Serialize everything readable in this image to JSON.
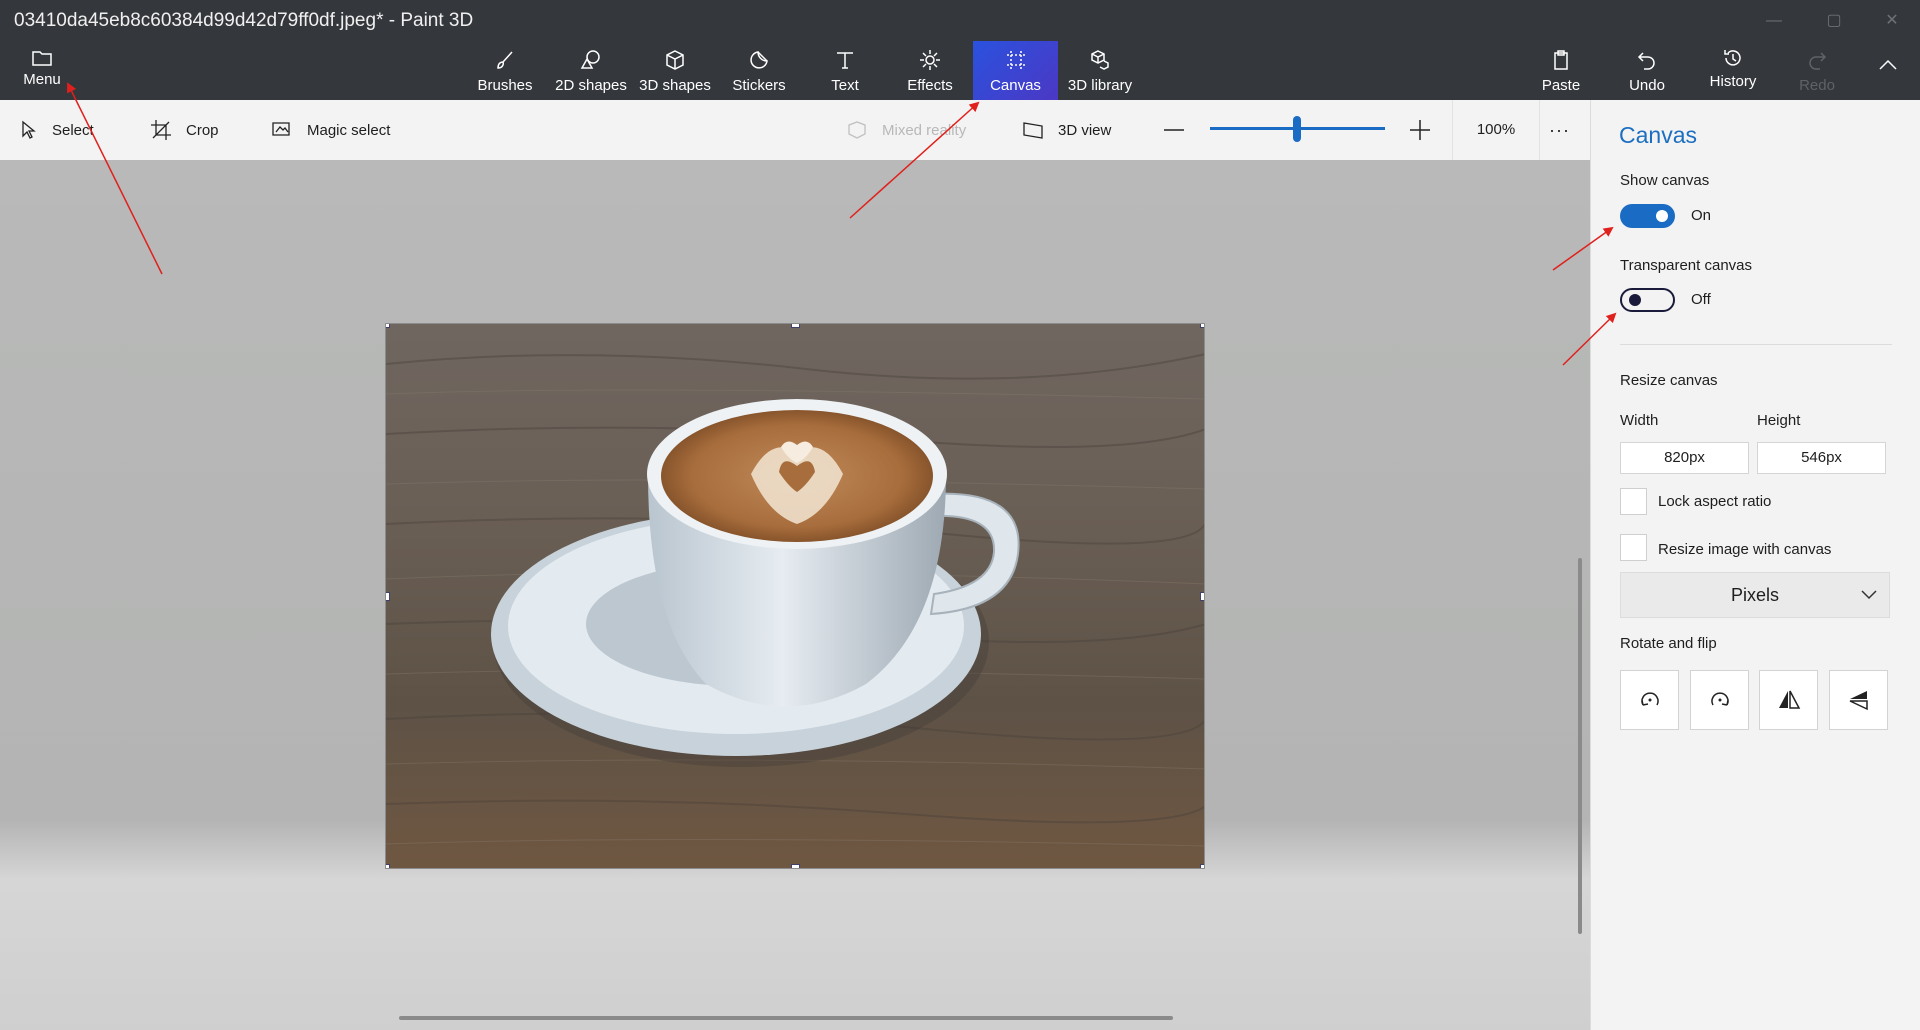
{
  "window": {
    "title": "03410da45eb8c60384d99d42d79ff0df.jpeg* - Paint 3D"
  },
  "ribbon": {
    "menu": "Menu",
    "tools": [
      {
        "label": "Brushes",
        "icon": "brush-icon"
      },
      {
        "label": "2D shapes",
        "icon": "2d-shapes-icon"
      },
      {
        "label": "3D shapes",
        "icon": "3d-shapes-icon"
      },
      {
        "label": "Stickers",
        "icon": "stickers-icon"
      },
      {
        "label": "Text",
        "icon": "text-icon"
      },
      {
        "label": "Effects",
        "icon": "effects-icon"
      },
      {
        "label": "Canvas",
        "icon": "canvas-icon",
        "active": true
      },
      {
        "label": "3D library",
        "icon": "3d-library-icon"
      }
    ],
    "paste": "Paste",
    "undo": "Undo",
    "history": "History",
    "redo": "Redo"
  },
  "toolbar": {
    "select": "Select",
    "crop": "Crop",
    "magic_select": "Magic select",
    "mixed_reality": "Mixed reality",
    "view_3d": "3D view",
    "zoom_level": "100%",
    "zoom_slider_fraction": 0.58,
    "more": "···"
  },
  "panel": {
    "title": "Canvas",
    "show_canvas": {
      "label": "Show canvas",
      "state": "On"
    },
    "transparent_canvas": {
      "label": "Transparent canvas",
      "state": "Off"
    },
    "resize_heading": "Resize canvas",
    "width_label": "Width",
    "height_label": "Height",
    "width_value": "820px",
    "height_value": "546px",
    "lock_aspect": "Lock aspect ratio",
    "resize_image": "Resize image with canvas",
    "units": "Pixels",
    "rotate_heading": "Rotate and flip",
    "rotate_buttons": [
      "rotate-left-icon",
      "rotate-right-icon",
      "flip-vertical-icon",
      "flip-horizontal-icon"
    ]
  },
  "colors": {
    "accent": "#1a6bc4",
    "title_bar": "#34373c",
    "annotation_arrow": "#e0201c"
  }
}
